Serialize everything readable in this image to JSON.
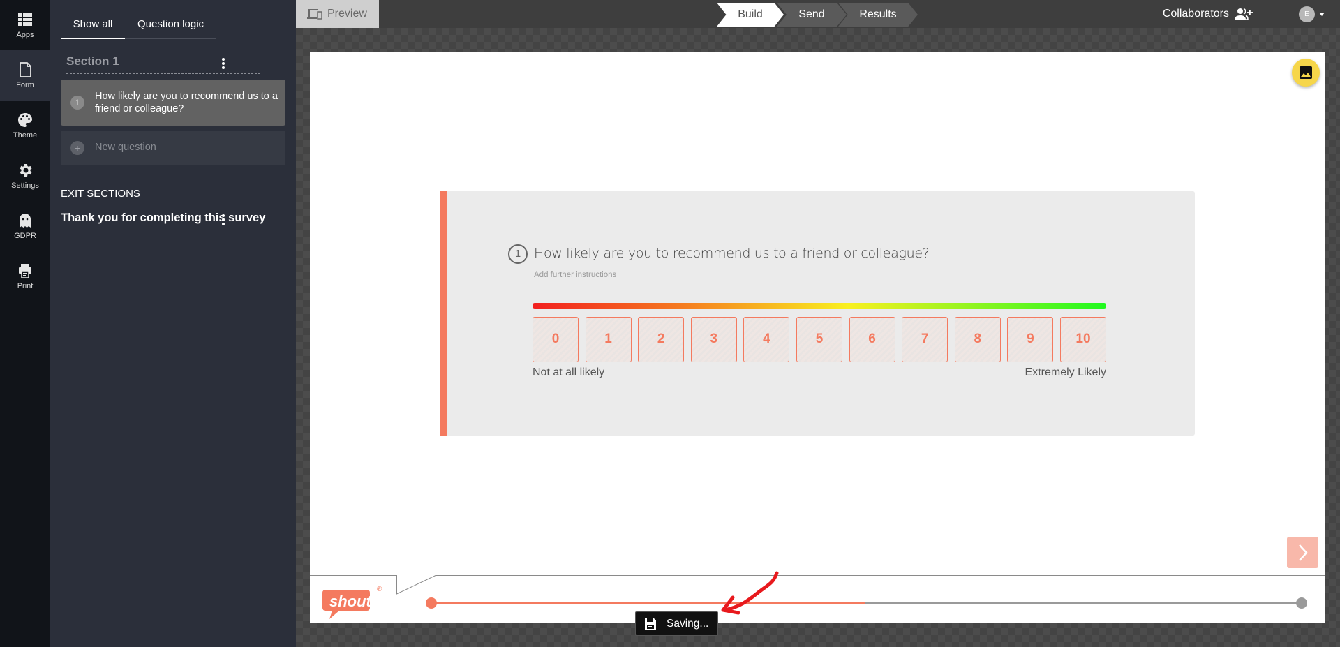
{
  "rail": {
    "items": [
      {
        "label": "Apps",
        "icon": "apps-icon",
        "active": false
      },
      {
        "label": "Form",
        "icon": "form-icon",
        "active": true
      },
      {
        "label": "Theme",
        "icon": "palette-icon",
        "active": false
      },
      {
        "label": "Settings",
        "icon": "gear-icon",
        "active": false
      },
      {
        "label": "GDPR",
        "icon": "ghost-icon",
        "active": false
      },
      {
        "label": "Print",
        "icon": "printer-icon",
        "active": false
      }
    ]
  },
  "panel": {
    "tabs": [
      {
        "label": "Show all",
        "active": true
      },
      {
        "label": "Question logic",
        "active": false
      }
    ],
    "section_title": "Section 1",
    "questions": [
      {
        "number": "1",
        "text": "How likely are you to recommend us to a friend or colleague?"
      }
    ],
    "new_question_label": "New question",
    "new_question_icon": "+",
    "exit_sections_title": "EXIT SECTIONS",
    "exit_items": [
      {
        "label": "Thank you for completing this survey"
      }
    ]
  },
  "topbar": {
    "preview_label": "Preview",
    "steps": [
      {
        "label": "Build",
        "active": true
      },
      {
        "label": "Send",
        "active": false
      },
      {
        "label": "Results",
        "active": false
      }
    ],
    "collaborators_label": "Collaborators",
    "avatar_initial": "E"
  },
  "canvas": {
    "question": {
      "number": "1",
      "title": "How likely are you to recommend us to a friend or colleague?",
      "instructions_placeholder": "Add further instructions",
      "scale": [
        "0",
        "1",
        "2",
        "3",
        "4",
        "5",
        "6",
        "7",
        "8",
        "9",
        "10"
      ],
      "min_label": "Not at all likely",
      "max_label": "Extremely Likely"
    },
    "progress": 0.5,
    "logo_text": "shout",
    "logo_mark": "®",
    "saving_label": "Saving..."
  },
  "colors": {
    "accent": "#f47a5f",
    "image_button": "#f6d64a",
    "annotation_arrow": "#e8191d"
  }
}
